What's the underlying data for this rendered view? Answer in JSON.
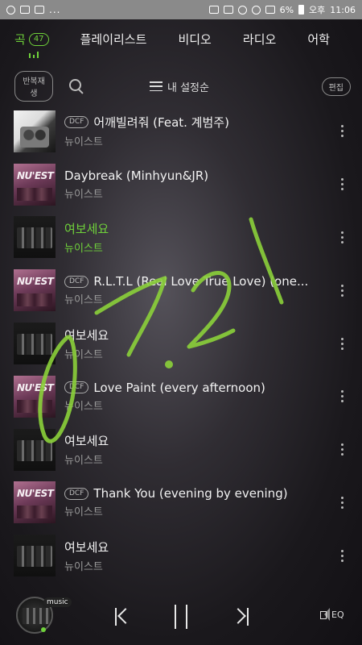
{
  "status_bar": {
    "left_icons": [
      "notification-icon",
      "image-icon",
      "mail-icon"
    ],
    "dots": "...",
    "battery": "6%",
    "meridiem": "오후",
    "time": "11:06"
  },
  "tabs": [
    {
      "label": "곡",
      "count": "47",
      "active": true
    },
    {
      "label": "플레이리스트"
    },
    {
      "label": "비디오"
    },
    {
      "label": "라디오"
    },
    {
      "label": "어학"
    }
  ],
  "toolbar": {
    "repeat_label": "반복재생",
    "sort_label": "내 설정순",
    "edit_label": "편집"
  },
  "songs": [
    {
      "dcf": "DCF",
      "title": "어깨빌려줘 (Feat. 계범주)",
      "artist": "뉴이스트"
    },
    {
      "dcf": "",
      "title": "Daybreak (Minhyun&JR)",
      "artist": "뉴이스트"
    },
    {
      "dcf": "",
      "title": "여보세요",
      "artist": "뉴이스트",
      "playing": true
    },
    {
      "dcf": "DCF",
      "title": "R.L.T.L (Real Love True Love) (one...",
      "artist": "뉴이스트"
    },
    {
      "dcf": "",
      "title": "여보세요",
      "artist": "뉴이스트"
    },
    {
      "dcf": "DCF",
      "title": "Love Paint (every afternoon)",
      "artist": "뉴이스트"
    },
    {
      "dcf": "",
      "title": "여보세요",
      "artist": "뉴이스트"
    },
    {
      "dcf": "DCF",
      "title": "Thank You (evening by evening)",
      "artist": "뉴이스트"
    },
    {
      "dcf": "",
      "title": "여보세요",
      "artist": "뉴이스트"
    }
  ],
  "player": {
    "tag": "music",
    "eq_label": "EQ"
  },
  "colors": {
    "accent": "#6fd13a",
    "status_bar": "#8a8a8a"
  },
  "overlay_handwriting": "07.21"
}
